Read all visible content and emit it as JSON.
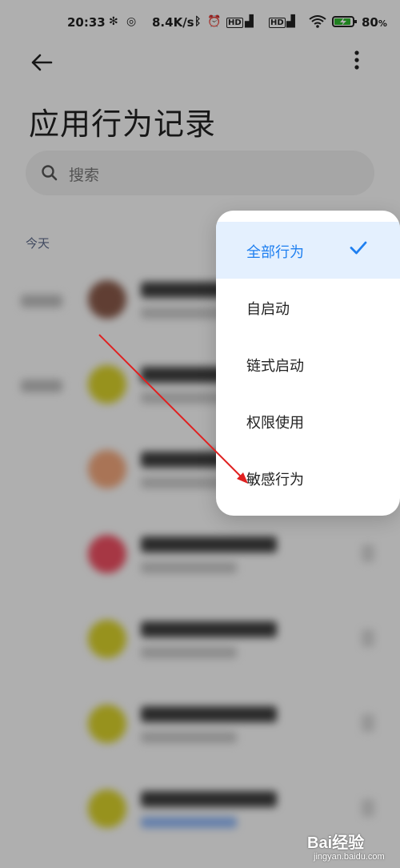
{
  "status_bar": {
    "time": "20:33",
    "speed": "8.4K/s",
    "battery": "80",
    "battery_unit": "%",
    "icons": [
      "gear-icon",
      "sync-icon",
      "bluetooth-icon",
      "alarm-icon",
      "hd-icon",
      "signal-5g-icon",
      "hd-icon",
      "signal-4g-icon",
      "wifi-icon",
      "battery-charging-icon"
    ]
  },
  "header": {
    "back_icon": "arrow-left-icon",
    "more_icon": "more-vertical-icon",
    "title": "应用行为记录"
  },
  "search": {
    "placeholder": "搜索",
    "icon": "search-icon"
  },
  "section": {
    "label": "今天"
  },
  "list": {
    "rows": [
      {
        "avatar_color": "#8a5a4a"
      },
      {
        "avatar_color": "#d9d12a"
      },
      {
        "avatar_color": "#f2a77c"
      },
      {
        "avatar_color": "#ee4f62"
      },
      {
        "avatar_color": "#d9d12a"
      },
      {
        "avatar_color": "#d9d12a"
      },
      {
        "avatar_color": "#d9d12a"
      }
    ]
  },
  "menu": {
    "items": [
      {
        "label": "全部行为",
        "selected": true
      },
      {
        "label": "自启动",
        "selected": false
      },
      {
        "label": "链式启动",
        "selected": false
      },
      {
        "label": "权限使用",
        "selected": false
      },
      {
        "label": "敏感行为",
        "selected": false
      }
    ],
    "check_icon": "check-icon",
    "accent_color": "#1e7ff0",
    "selected_bg": "#e4f0fe"
  },
  "annotation": {
    "arrow_color": "#e02020"
  },
  "watermark": {
    "brand": "Bai经验",
    "site": "jingyan.baidu.com"
  }
}
